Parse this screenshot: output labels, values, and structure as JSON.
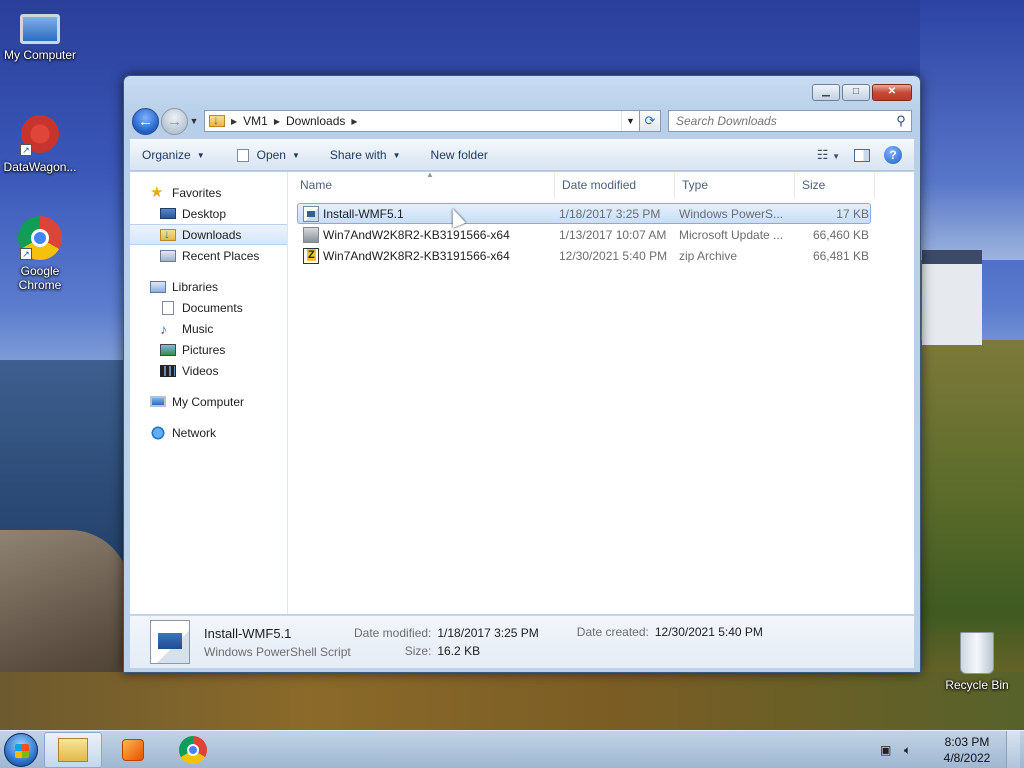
{
  "desktop": {
    "icons": [
      {
        "label": "My Computer",
        "icon": "computer-icon"
      },
      {
        "label": "DataWagon...",
        "icon": "datawagon-icon"
      },
      {
        "label": "Google Chrome",
        "icon": "chrome-icon"
      },
      {
        "label": "Recycle Bin",
        "icon": "recycle-bin-icon"
      }
    ]
  },
  "window": {
    "breadcrumb": [
      "VM1",
      "Downloads"
    ],
    "search_placeholder": "Search Downloads",
    "toolbar": {
      "organize": "Organize",
      "open": "Open",
      "share_with": "Share with",
      "new_folder": "New folder"
    },
    "nav": {
      "favorites": "Favorites",
      "desktop": "Desktop",
      "downloads": "Downloads",
      "recent_places": "Recent Places",
      "libraries": "Libraries",
      "documents": "Documents",
      "music": "Music",
      "pictures": "Pictures",
      "videos": "Videos",
      "my_computer": "My Computer",
      "network": "Network"
    },
    "columns": {
      "name": "Name",
      "date": "Date modified",
      "type": "Type",
      "size": "Size"
    },
    "files": [
      {
        "name": "Install-WMF5.1",
        "date": "1/18/2017 3:25 PM",
        "type": "Windows PowerS...",
        "size": "17 KB",
        "icon": "powershell-script-icon"
      },
      {
        "name": "Win7AndW2K8R2-KB3191566-x64",
        "date": "1/13/2017 10:07 AM",
        "type": "Microsoft Update ...",
        "size": "66,460 KB",
        "icon": "update-package-icon"
      },
      {
        "name": "Win7AndW2K8R2-KB3191566-x64",
        "date": "12/30/2021 5:40 PM",
        "type": "zip Archive",
        "size": "66,481 KB",
        "icon": "zip-archive-icon"
      }
    ],
    "details": {
      "name": "Install-WMF5.1",
      "type": "Windows PowerShell Script",
      "date_modified_label": "Date modified:",
      "date_modified": "1/18/2017 3:25 PM",
      "size_label": "Size:",
      "size": "16.2 KB",
      "date_created_label": "Date created:",
      "date_created": "12/30/2021 5:40 PM"
    }
  },
  "taskbar": {
    "time": "8:03 PM",
    "date": "4/8/2022"
  }
}
